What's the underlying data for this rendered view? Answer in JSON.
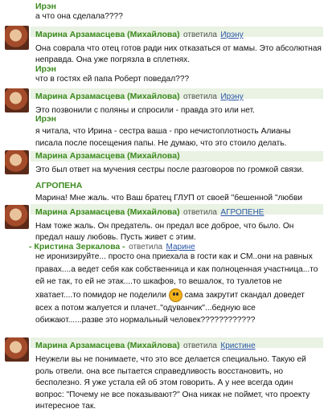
{
  "posts": [
    {
      "author": "Ирэн",
      "text": "а что она сделала????"
    },
    {
      "author": "Марина Арзамасцева (Михайлова)",
      "reply_label": "ответила",
      "reply_to": "Ирэну",
      "text": "Она соврала что отец готов ради них отказаться от мамы. Это абсолютная неправда. Она уже погрязла в сплетнях."
    },
    {
      "author": "Ирэн",
      "text": "что в гостях ей папа Роберт поведал???"
    },
    {
      "author": "Марина Арзамасцева (Михайлова)",
      "reply_label": "ответила",
      "reply_to": "Ирэну",
      "text": "Это позвонили с поляны и спросили - правда это или нет."
    },
    {
      "author": "Ирэн",
      "text": "я читала, что Ирина - сестра ваша - про нечистоплотность Алианы писала после посещения папы. Не думаю, что это стоило делать."
    },
    {
      "author": "Марина Арзамасцева (Михайлова)",
      "text": "Это был ответ на мучения сестры после разговоров по громкой связи."
    },
    {
      "author": "АГРОПЕНА",
      "text": "Марина! Мне жаль. что  Ваш братец ГЛУП от своей \"бешенной \"любви"
    },
    {
      "author": "Марина Арзамасцева (Михайлова)",
      "reply_label": "ответила",
      "reply_to": "АГРОПЕНЕ",
      "text": "Нам тоже жаль. Он предатель. он предал все доброе, что было. Он предал нашу любовь. Пусть живет с этим."
    },
    {
      "author": "- Кристина Зеркалова -",
      "reply_label": "ответила",
      "reply_to": "Марине",
      "text1": "не иронизируйте... просто она приехала в гости как и СМ..они на равных правах....а ведет себя как  собственница и как полноценная участница...то ей не так, то ей не этак....то шкафов, то вешалок, то туалетов не хватает....то помидор не поделили",
      "text2": "сама закрутит скандал доведет всех а потом жалуется и плачет..\"одуванчик\"...бедную все обижают......разве это нормальный человек????????????"
    },
    {
      "author": "Марина Арзамасцева (Михайлова)",
      "reply_label": "ответила",
      "reply_to": "Кристине",
      "text": "Неужели вы не понимаете, что это все делается специально. Такую ей роль отвели. она все пытается справедливость восстановить, но бесполезно. Я уже устала ей об этом говорить. А у нее всегда один вопрос: \"Почему не все показывают?\" Она никак не поймет, что проекту интересное так."
    }
  ]
}
